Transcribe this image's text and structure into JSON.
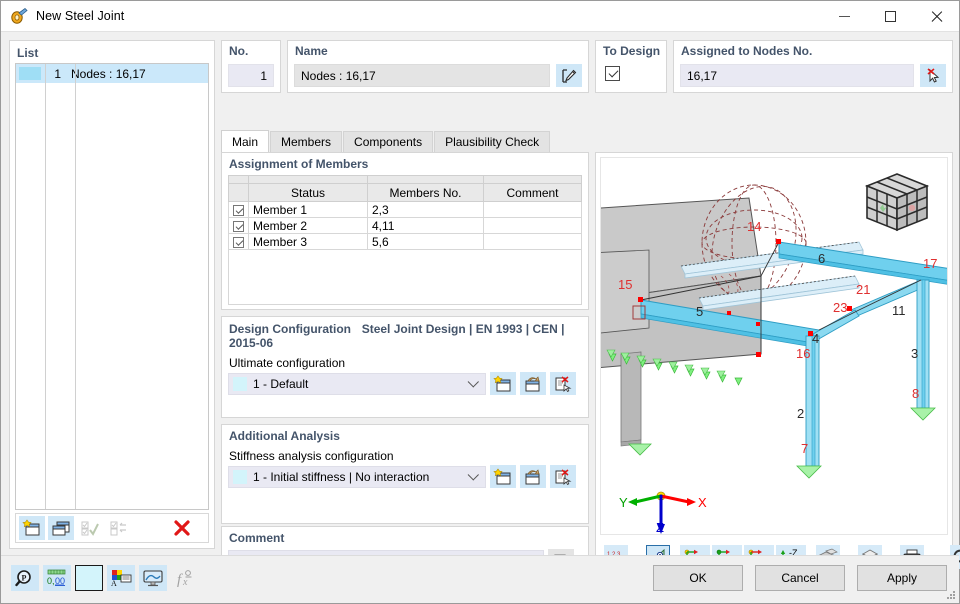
{
  "window": {
    "title": "New Steel Joint",
    "icon": "steel-joint-icon",
    "minimize_label": "Minimize",
    "maximize_label": "Maximize",
    "close_label": "Close"
  },
  "list_panel": {
    "label": "List",
    "rows": [
      {
        "no": "1",
        "name": "Nodes : 16,17",
        "color": "#9fdef5"
      }
    ],
    "toolbar": [
      {
        "name": "new-item-button",
        "icon": "new-window-icon"
      },
      {
        "name": "copy-item-button",
        "icon": "copy-window-icon"
      },
      {
        "name": "select-all-button",
        "icon": "check-all-icon"
      },
      {
        "name": "invert-selection-button",
        "icon": "invert-check-icon"
      },
      {
        "name": "delete-item-button",
        "icon": "red-x-icon"
      }
    ]
  },
  "fields": {
    "no": {
      "label": "No.",
      "value": "1"
    },
    "name": {
      "label": "Name",
      "value": "Nodes : 16,17",
      "edit_icon": "pencil-box-icon"
    },
    "to_design": {
      "label": "To Design",
      "checked": true
    },
    "assigned": {
      "label": "Assigned to Nodes No.",
      "value": "16,17",
      "pick_icon": "pick-cursor-icon"
    }
  },
  "tabs": [
    {
      "label": "Main",
      "active": true
    },
    {
      "label": "Members",
      "active": false
    },
    {
      "label": "Components",
      "active": false
    },
    {
      "label": "Plausibility Check",
      "active": false
    }
  ],
  "assignment": {
    "title": "Assignment of Members",
    "columns": [
      "",
      "Status",
      "Members No.",
      "Comment"
    ],
    "rows": [
      {
        "checked": true,
        "status": "Member 1",
        "members_no": "2,3",
        "comment": ""
      },
      {
        "checked": true,
        "status": "Member 2",
        "members_no": "4,11",
        "comment": ""
      },
      {
        "checked": true,
        "status": "Member 3",
        "members_no": "5,6",
        "comment": ""
      }
    ]
  },
  "design_configuration": {
    "title": "Design Configuration",
    "standard": "Steel Joint Design | EN 1993 | CEN | 2015-06",
    "field_label": "Ultimate configuration",
    "value": "1 - Default",
    "chip_color": "#d3f4fb",
    "buttons": [
      {
        "name": "new-configuration-button",
        "icon": "new-config-icon"
      },
      {
        "name": "edit-configuration-button",
        "icon": "edit-config-icon"
      },
      {
        "name": "delete-configuration-button",
        "icon": "delete-config-icon"
      }
    ]
  },
  "additional_analysis": {
    "title": "Additional Analysis",
    "field_label": "Stiffness analysis configuration",
    "value": "1 - Initial stiffness | No interaction",
    "chip_color": "#d3f4fb",
    "buttons": [
      {
        "name": "new-stiffness-config-button",
        "icon": "new-config-icon"
      },
      {
        "name": "edit-stiffness-config-button",
        "icon": "edit-config-icon"
      },
      {
        "name": "delete-stiffness-config-button",
        "icon": "delete-config-icon"
      }
    ]
  },
  "comment": {
    "title": "Comment",
    "value": "",
    "copy_icon": "copy-pages-icon"
  },
  "viewport": {
    "model": {
      "member_labels": [
        "5",
        "6",
        "4",
        "11",
        "2",
        "3"
      ],
      "node_labels": [
        "14",
        "15",
        "16",
        "17",
        "21",
        "23",
        "7",
        "8"
      ],
      "axis_labels": [
        "X",
        "Y",
        "Z"
      ],
      "colors": {
        "member": "#7fd4f0",
        "slab": "#c8c8c8",
        "node": "#ff0000",
        "support": "#7ff07f",
        "axis_x": "#ff0000",
        "axis_y": "#00b000",
        "axis_z": "#0000cc"
      }
    },
    "nav_cube": "navigation-cube-icon",
    "toolbar": [
      {
        "name": "dimensions-button",
        "icon": "dimension-123-icon",
        "dropdown": true
      },
      {
        "name": "render-mode-button",
        "icon": "render-triangle-icon",
        "selected": true
      },
      {
        "name": "view-in-x-button",
        "icon": "axis-x-icon",
        "label": "X"
      },
      {
        "name": "view-in-minus-y-button",
        "icon": "axis-minus-y-icon",
        "label": "-Y"
      },
      {
        "name": "view-in-z-button",
        "icon": "axis-z-icon",
        "label": "Z"
      },
      {
        "name": "view-in-minus-z-button",
        "icon": "axis-minus-z-icon",
        "label": "-Z"
      },
      {
        "name": "display-mode-button",
        "icon": "solid-cube-icon",
        "dropdown": true
      },
      {
        "name": "wireframe-button",
        "icon": "wire-cube-icon",
        "dropdown": true
      },
      {
        "name": "print-button",
        "icon": "printer-icon",
        "dropdown": true
      },
      {
        "name": "reset-zoom-button",
        "icon": "zoom-reset-icon"
      }
    ]
  },
  "bottom_bar": {
    "tools": [
      {
        "name": "find-button",
        "icon": "magnifier-p-icon"
      },
      {
        "name": "number-format-button",
        "icon": "number-format-icon",
        "label": "0,00"
      },
      {
        "name": "color-swatch-button",
        "icon": "color-swatch-icon",
        "color": "#d3f4fb"
      },
      {
        "name": "display-properties-button",
        "icon": "display-properties-icon"
      },
      {
        "name": "view-settings-button",
        "icon": "monitor-icon"
      },
      {
        "name": "formula-button",
        "icon": "function-icon"
      }
    ],
    "buttons": [
      {
        "name": "ok-button",
        "label": "OK"
      },
      {
        "name": "cancel-button",
        "label": "Cancel"
      },
      {
        "name": "apply-button",
        "label": "Apply"
      }
    ]
  }
}
